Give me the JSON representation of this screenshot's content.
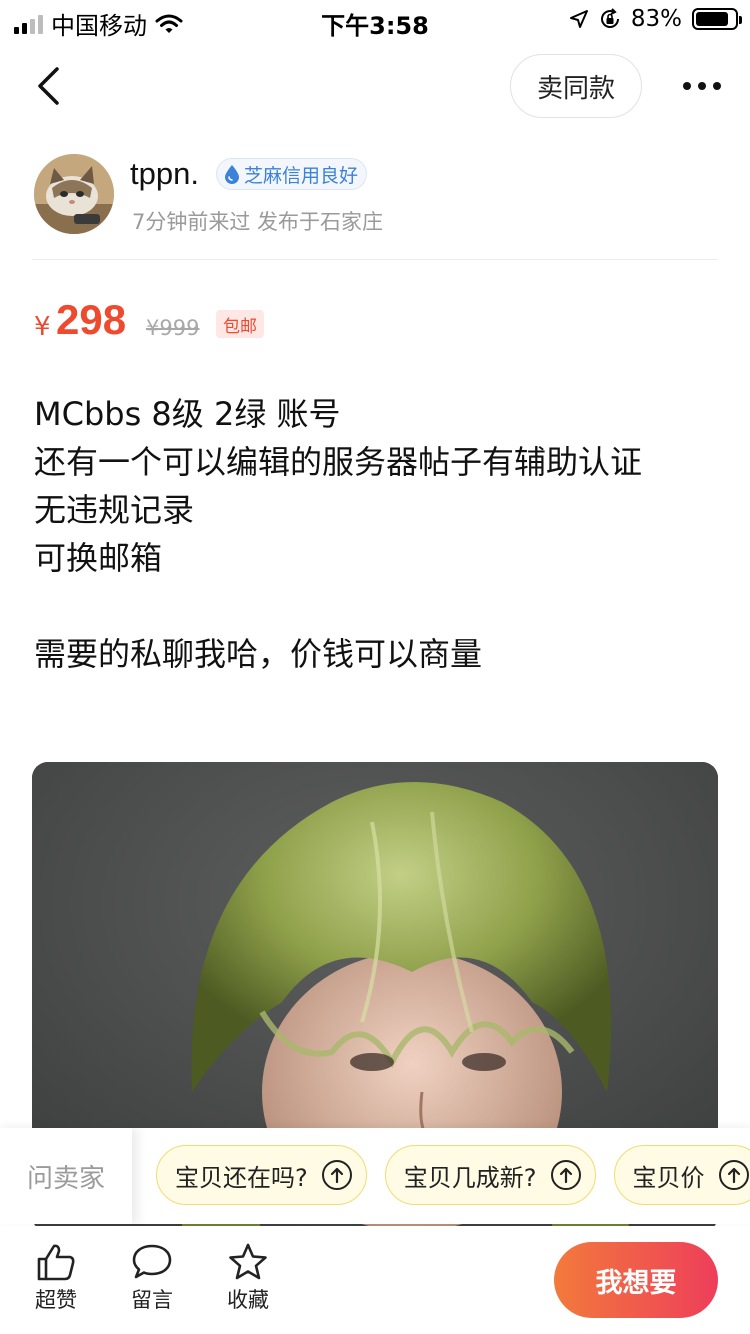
{
  "status_bar": {
    "carrier": "中国移动",
    "time": "下午3:58",
    "battery_percent": "83%",
    "battery_level": 0.83
  },
  "nav": {
    "sell_same_label": "卖同款"
  },
  "seller": {
    "name": "tppn.",
    "credit_badge": "芝麻信用良好",
    "meta": "7分钟前来过 发布于石家庄"
  },
  "price": {
    "currency": "¥",
    "current": "298",
    "original": "¥999",
    "shipping": "包邮"
  },
  "description": {
    "lines": [
      "MCbbs 8级 2绿 账号",
      "还有一个可以编辑的服务器帖子有辅助认证",
      "无违规记录",
      "可换邮箱",
      "",
      "需要的私聊我哈，价钱可以商量"
    ]
  },
  "questions": {
    "ask_label": "问卖家",
    "chips": [
      "宝贝还在吗?",
      "宝贝几成新?",
      "宝贝价"
    ]
  },
  "actions": {
    "like_label": "超赞",
    "comment_label": "留言",
    "favorite_label": "收藏",
    "want_label": "我想要"
  },
  "colors": {
    "price": "#ee4a2f",
    "credit_blue": "#3b82d8",
    "chip_border": "#f1dc73",
    "want_gradient_start": "#f27a3c",
    "want_gradient_end": "#ee3e5a"
  }
}
